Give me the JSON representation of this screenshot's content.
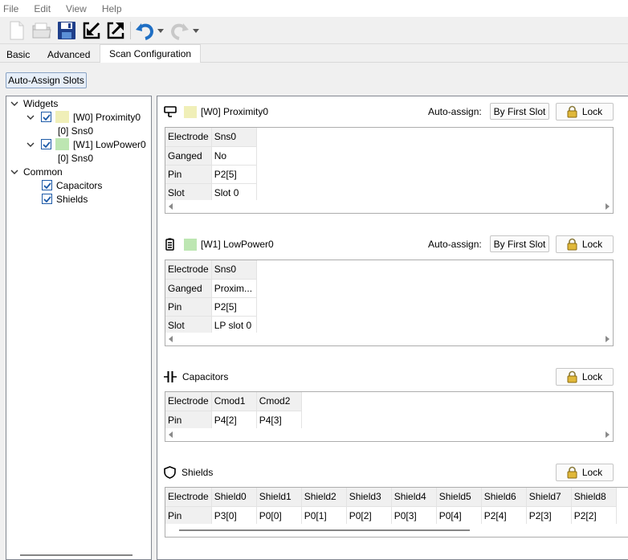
{
  "menu": {
    "file": "File",
    "edit": "Edit",
    "view": "View",
    "help": "Help"
  },
  "toolbar": {
    "icons": [
      "new-file-icon",
      "open-folder-icon",
      "save-icon",
      "import-icon",
      "export-icon",
      "undo-icon",
      "undo-dropdown-icon",
      "redo-icon",
      "redo-dropdown-icon"
    ]
  },
  "tabs": [
    "Basic",
    "Advanced",
    "Scan Configuration"
  ],
  "active_tab": "Scan Configuration",
  "auto_assign_slots": "Auto-Assign Slots",
  "tree": {
    "widgets": "Widgets",
    "w0": "[W0] Proximity0",
    "w0_sensor": "[0] Sns0",
    "w1": "[W1] LowPower0",
    "w1_sensor": "[0] Sns0",
    "common": "Common",
    "capacitors": "Capacitors",
    "shields": "Shields"
  },
  "colors": {
    "w0_swatch": "#f0efb8",
    "w1_swatch": "#bde6b2",
    "checkbox": "#1e5ba8",
    "toolbar_blue": "#1f6fc4"
  },
  "sections": {
    "proximity": {
      "title": "[W0] Proximity0",
      "auto_assign_label": "Auto-assign:",
      "auto_assign_button": "By First Slot",
      "lock": "Lock",
      "rows": [
        {
          "label": "Electrode",
          "value": "Sns0"
        },
        {
          "label": "Ganged",
          "value": "No"
        },
        {
          "label": "Pin",
          "value": "P2[5]"
        },
        {
          "label": "Slot",
          "value": "Slot 0"
        }
      ]
    },
    "lowpower": {
      "title": "[W1] LowPower0",
      "auto_assign_label": "Auto-assign:",
      "auto_assign_button": "By First Slot",
      "lock": "Lock",
      "rows": [
        {
          "label": "Electrode",
          "value": "Sns0"
        },
        {
          "label": "Ganged",
          "value": "Proxim..."
        },
        {
          "label": "Pin",
          "value": "P2[5]"
        },
        {
          "label": "Slot",
          "value": "LP slot 0"
        }
      ]
    },
    "capacitors": {
      "title": "Capacitors",
      "lock": "Lock",
      "electrode_label": "Electrode",
      "pin_label": "Pin",
      "electrodes": [
        "Cmod1",
        "Cmod2"
      ],
      "pins": [
        "P4[2]",
        "P4[3]"
      ]
    },
    "shields": {
      "title": "Shields",
      "lock": "Lock",
      "electrode_label": "Electrode",
      "pin_label": "Pin",
      "electrodes": [
        "Shield0",
        "Shield1",
        "Shield2",
        "Shield3",
        "Shield4",
        "Shield5",
        "Shield6",
        "Shield7",
        "Shield8"
      ],
      "pins": [
        "P3[0]",
        "P0[0]",
        "P0[1]",
        "P0[2]",
        "P0[3]",
        "P0[4]",
        "P2[4]",
        "P2[3]",
        "P2[2]"
      ]
    }
  }
}
